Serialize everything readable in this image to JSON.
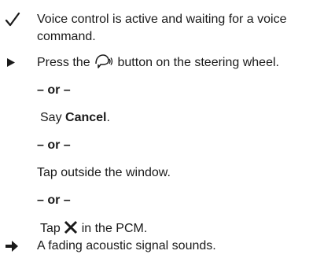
{
  "items": {
    "condition": {
      "icon": "checkmark-icon",
      "line1": "Voice control is active and waiting for a voice",
      "line2": "command."
    },
    "step": {
      "icon": "triangle-bullet-icon",
      "pre": "Press the",
      "button_icon": "voice-control-steering-button-icon",
      "post": "button on the steering wheel."
    },
    "alternatives": [
      {
        "separator": "– or –",
        "pre": "Say ",
        "bold": "Cancel",
        "post": "."
      },
      {
        "separator": "– or –",
        "text": "Tap outside the window."
      },
      {
        "separator": "– or –",
        "pre": "Tap",
        "icon": "close-x-icon",
        "post": "in the PCM."
      }
    ],
    "result": {
      "icon": "arrow-right-icon",
      "text": "A fading acoustic signal sounds."
    }
  }
}
